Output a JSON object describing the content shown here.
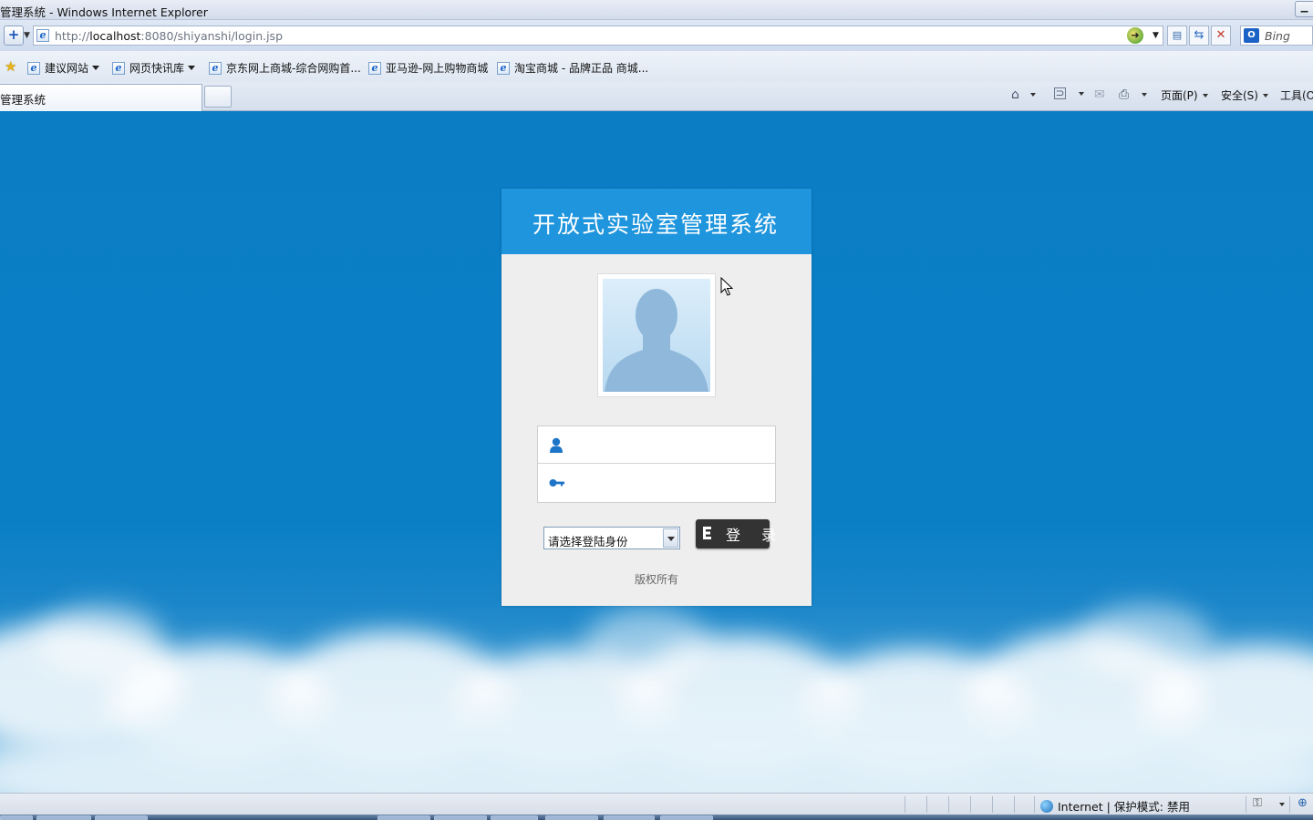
{
  "window": {
    "title": "管理系统 - Windows Internet Explorer"
  },
  "address": {
    "url_prefix": "http://",
    "url_host": "localhost",
    "url_rest": ":8080/shiyanshi/login.jsp",
    "search_placeholder": "Bing"
  },
  "favorites": {
    "items": [
      {
        "label": "建议网站",
        "has_menu": true
      },
      {
        "label": "网页快讯库",
        "has_menu": true
      },
      {
        "label": "京东网上商城-综合网购首..."
      },
      {
        "label": "亚马逊-网上购物商城"
      },
      {
        "label": "淘宝商城 - 品牌正品 商城..."
      }
    ]
  },
  "tabs": {
    "active_label": "管理系统"
  },
  "command_bar": {
    "page_label": "页面(P)",
    "safety_label": "安全(S)",
    "tools_label": "工具(O)"
  },
  "login": {
    "title": "开放式实验室管理系统",
    "username_placeholder": "",
    "password_placeholder": "",
    "role_select_value": "请选择登陆身份",
    "login_button_label": "登 录",
    "copyright": "版权所有"
  },
  "status": {
    "zone_text": "Internet | 保护模式: 禁用"
  },
  "colors": {
    "page_bg": "#0a7fc6",
    "header_bg": "#1e95dd",
    "card_bg": "#eeeeee",
    "button_bg": "#333333"
  }
}
